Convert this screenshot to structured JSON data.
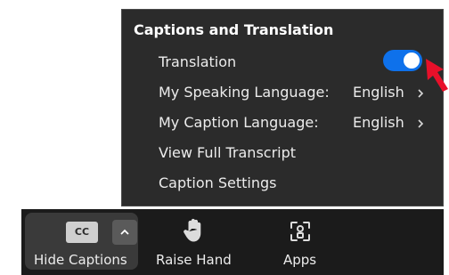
{
  "menu": {
    "title": "Captions and Translation",
    "translation_label": "Translation",
    "translation_enabled": true,
    "speaking_language_label": "My Speaking Language:",
    "speaking_language_value": "English",
    "caption_language_label": "My Caption Language:",
    "caption_language_value": "English",
    "transcript_label": "View Full Transcript",
    "settings_label": "Caption Settings"
  },
  "toolbar": {
    "cc_badge": "CC",
    "hide_captions_label": "Hide Captions",
    "raise_hand_label": "Raise Hand",
    "apps_label": "Apps"
  },
  "icons": {
    "chevron": "chevron-right-icon",
    "caret": "chevron-up-icon",
    "raise_hand": "hand-icon",
    "apps": "apps-icon",
    "annotation_arrow": "red-arrow-icon"
  },
  "colors": {
    "menu_bg": "#2b2b2b",
    "toggle_on": "#0e71eb",
    "toolbar_bg": "#1b1b1b",
    "arrow": "#e8102a"
  }
}
